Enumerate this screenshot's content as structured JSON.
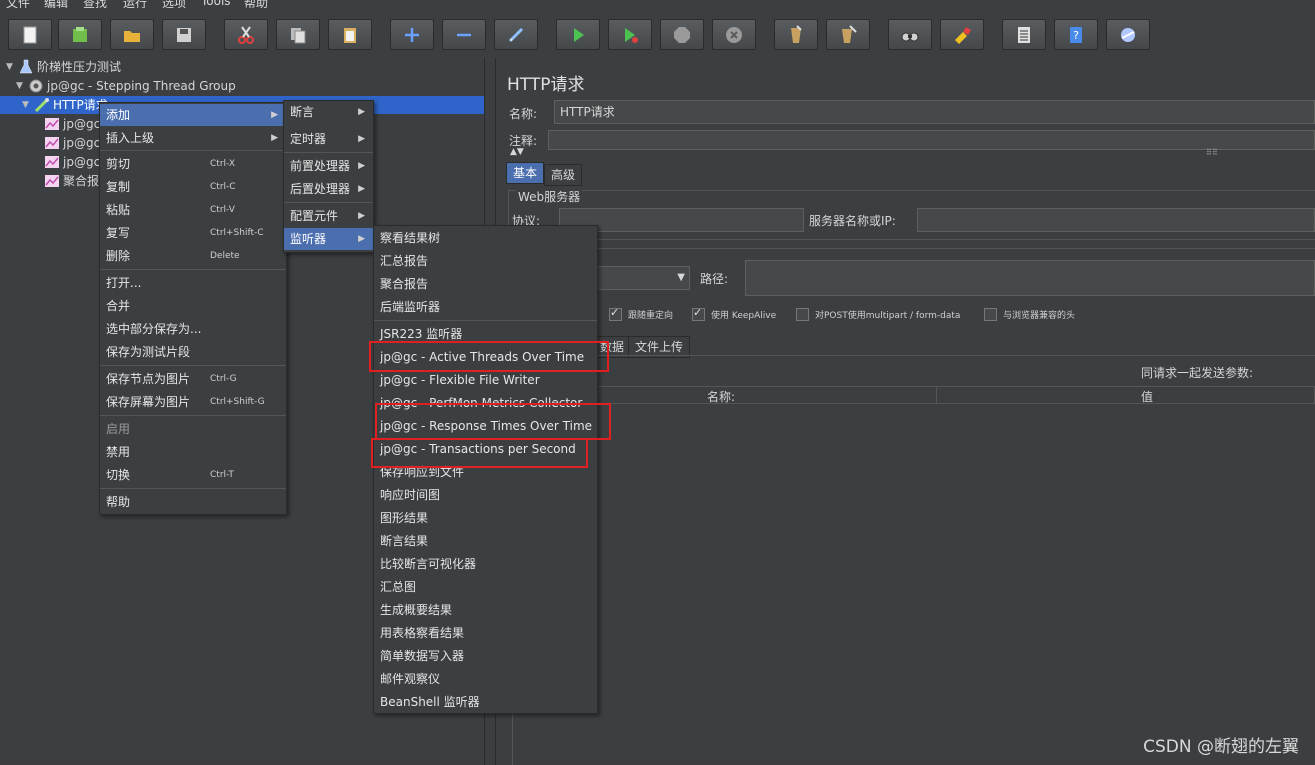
{
  "menubar": [
    "文件",
    "编辑",
    "查找",
    "运行",
    "选项",
    "Tools",
    "帮助"
  ],
  "toolbar": {
    "buttons": [
      {
        "name": "new-icon",
        "color": "#f2f2f2"
      },
      {
        "name": "templates-icon",
        "color": "#6fbf4a"
      },
      {
        "name": "open-icon",
        "color": "#e8b23a"
      },
      {
        "name": "save-icon",
        "color": "#d0d0d0"
      },
      {
        "name": "cut-icon",
        "color": "#e04040"
      },
      {
        "name": "copy-icon",
        "color": "#d0d0d0"
      },
      {
        "name": "paste-icon",
        "color": "#d8b060"
      },
      {
        "name": "expand-icon",
        "color": "#6ba0ff"
      },
      {
        "name": "collapse-icon",
        "color": "#6ba0ff"
      },
      {
        "name": "toggle-icon",
        "color": "#8fc0ff"
      },
      {
        "name": "start-icon",
        "color": "#4cc050"
      },
      {
        "name": "start-no-pause-icon",
        "color": "#4cc050"
      },
      {
        "name": "stop-icon",
        "color": "#9a9a9a"
      },
      {
        "name": "shutdown-icon",
        "color": "#9a9a9a"
      },
      {
        "name": "clear-icon",
        "color": "#c8a060"
      },
      {
        "name": "clear-all-icon",
        "color": "#c8a060"
      },
      {
        "name": "search-icon",
        "color": "#d0d0d0"
      },
      {
        "name": "reset-search-icon",
        "color": "#f0c020"
      },
      {
        "name": "function-helper-icon",
        "color": "#e0e0e0"
      },
      {
        "name": "help-icon",
        "color": "#4a8ae8"
      },
      {
        "name": "remote-icon",
        "color": "#b0c8ff"
      }
    ]
  },
  "tree": {
    "root": "阶梯性压力测试",
    "thread_group": "jp@gc - Stepping Thread Group",
    "sampler": "HTTP请求",
    "children": [
      "jp@gc",
      "jp@gc",
      "jp@gc",
      "聚合报"
    ]
  },
  "context_menu": {
    "items": [
      {
        "label": "添加",
        "shortcut": "",
        "submenu": true
      },
      {
        "label": "插入上级",
        "shortcut": "",
        "submenu": true
      },
      {
        "label": "剪切",
        "shortcut": "Ctrl-X"
      },
      {
        "label": "复制",
        "shortcut": "Ctrl-C"
      },
      {
        "label": "粘贴",
        "shortcut": "Ctrl-V"
      },
      {
        "label": "复写",
        "shortcut": "Ctrl+Shift-C"
      },
      {
        "label": "删除",
        "shortcut": "Delete"
      },
      {
        "label": "打开...",
        "shortcut": ""
      },
      {
        "label": "合并",
        "shortcut": ""
      },
      {
        "label": "选中部分保存为...",
        "shortcut": ""
      },
      {
        "label": "保存为测试片段",
        "shortcut": ""
      },
      {
        "label": "保存节点为图片",
        "shortcut": "Ctrl-G"
      },
      {
        "label": "保存屏幕为图片",
        "shortcut": "Ctrl+Shift-G"
      },
      {
        "label": "启用",
        "shortcut": ""
      },
      {
        "label": "禁用",
        "shortcut": ""
      },
      {
        "label": "切换",
        "shortcut": "Ctrl-T"
      },
      {
        "label": "帮助",
        "shortcut": ""
      }
    ]
  },
  "add_submenu": {
    "items": [
      "断言",
      "定时器",
      "前置处理器",
      "后置处理器",
      "配置元件",
      "监听器"
    ]
  },
  "listener_submenu": {
    "items": [
      "察看结果树",
      "汇总报告",
      "聚合报告",
      "后端监听器",
      "JSR223 监听器",
      "jp@gc - Active Threads Over Time",
      "jp@gc - Flexible File Writer",
      "jp@gc - PerfMon Metrics Collector",
      "jp@gc - Response Times Over Time",
      "jp@gc - Transactions per Second",
      "保存响应到文件",
      "响应时间图",
      "图形结果",
      "断言结果",
      "比较断言可视化器",
      "汇总图",
      "生成概要结果",
      "用表格察看结果",
      "简单数据写入器",
      "邮件观察仪",
      "BeanShell 监听器"
    ]
  },
  "http_panel": {
    "title": "HTTP请求",
    "name_label": "名称:",
    "name_value": "HTTP请求",
    "comment_label": "注释:",
    "tabs": [
      "基本",
      "高级"
    ],
    "web_server_legend": "Web服务器",
    "protocol_label": "协议:",
    "server_label": "服务器名称或IP:",
    "path_label": "路径:",
    "checkboxes": [
      {
        "label": "跟随重定向",
        "checked": true
      },
      {
        "label": "使用 KeepAlive",
        "checked": true
      },
      {
        "label": "对POST使用multipart / form-data",
        "checked": false
      },
      {
        "label": "与浏览器兼容的头",
        "checked": false
      }
    ],
    "param_tabs": [
      "数据",
      "文件上传"
    ],
    "send_params_label": "同请求一起发送参数:",
    "table_headers": [
      "名称:",
      "值"
    ]
  },
  "watermark": "CSDN @断翅的左翼",
  "colors": {
    "highlight": "#4b6eaf",
    "annotation": "#e02020"
  }
}
